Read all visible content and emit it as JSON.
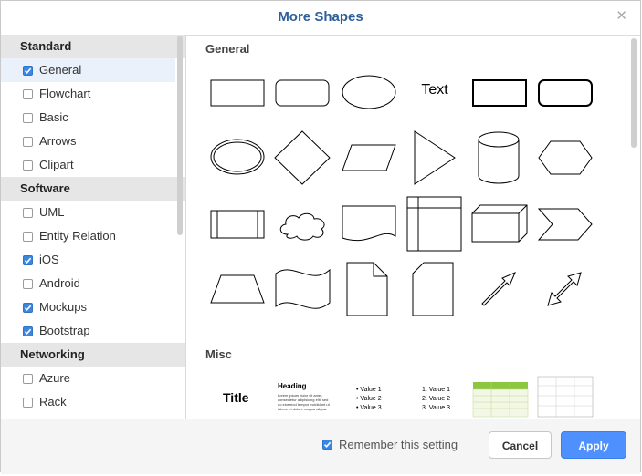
{
  "dialog": {
    "title": "More Shapes"
  },
  "sidebar": {
    "groups": [
      {
        "label": "Standard",
        "items": [
          {
            "label": "General",
            "checked": true,
            "selected": true
          },
          {
            "label": "Flowchart",
            "checked": false
          },
          {
            "label": "Basic",
            "checked": false
          },
          {
            "label": "Arrows",
            "checked": false
          },
          {
            "label": "Clipart",
            "checked": false
          }
        ]
      },
      {
        "label": "Software",
        "items": [
          {
            "label": "UML",
            "checked": false
          },
          {
            "label": "Entity Relation",
            "checked": false
          },
          {
            "label": "iOS",
            "checked": true
          },
          {
            "label": "Android",
            "checked": false
          },
          {
            "label": "Mockups",
            "checked": true
          },
          {
            "label": "Bootstrap",
            "checked": true
          }
        ]
      },
      {
        "label": "Networking",
        "items": [
          {
            "label": "Azure",
            "checked": false
          },
          {
            "label": "Rack",
            "checked": false
          }
        ]
      }
    ]
  },
  "main": {
    "sections": [
      {
        "title": "General"
      },
      {
        "title": "Misc"
      }
    ],
    "shape_labels": {
      "text": "Text",
      "title": "Title",
      "heading": "Heading",
      "heading_body": "Lorem ipsum dolor sit amet, consectetur adipisicing elit, sed do eiusmod tempor incididunt ut labore et dolore magna aliqua.",
      "bullets": [
        "Value 1",
        "Value 2",
        "Value 3"
      ],
      "numbered": [
        "1.  Value 1",
        "2.  Value 2",
        "3.  Value 3"
      ]
    }
  },
  "footer": {
    "remember_label": "Remember this setting",
    "remember_checked": true,
    "cancel_label": "Cancel",
    "apply_label": "Apply"
  },
  "colors": {
    "title": "#2c5f9c",
    "accent": "#4d90fe",
    "table_green": "#8dc63f"
  }
}
